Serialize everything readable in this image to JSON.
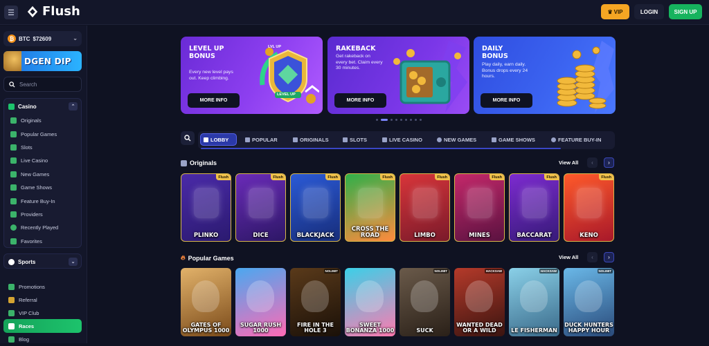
{
  "header": {
    "brand": "Flush",
    "vip_label": "VIP",
    "login_label": "LOGIN",
    "signup_label": "SIGN UP"
  },
  "sidebar": {
    "wallet": {
      "currency": "BTC",
      "amount": "$72609"
    },
    "promo_label": "DGEN DIP",
    "search_placeholder": "Search",
    "casino": {
      "label": "Casino",
      "items": [
        {
          "label": "Originals",
          "icon": "originals-icon"
        },
        {
          "label": "Popular Games",
          "icon": "flame-icon"
        },
        {
          "label": "Slots",
          "icon": "slots-icon"
        },
        {
          "label": "Live Casino",
          "icon": "live-icon"
        },
        {
          "label": "New Games",
          "icon": "new-icon"
        },
        {
          "label": "Game Shows",
          "icon": "tv-icon"
        },
        {
          "label": "Feature Buy-In",
          "icon": "buy-icon"
        },
        {
          "label": "Providers",
          "icon": "providers-icon"
        },
        {
          "label": "Recently Played",
          "icon": "history-icon"
        },
        {
          "label": "Favorites",
          "icon": "star-icon"
        }
      ]
    },
    "sports_label": "Sports",
    "links": [
      {
        "label": "Promotions",
        "icon": "gift-icon"
      },
      {
        "label": "Referral",
        "icon": "referral-icon"
      },
      {
        "label": "VIP Club",
        "icon": "crown-icon"
      },
      {
        "label": "Races",
        "icon": "flag-icon"
      },
      {
        "label": "Blog",
        "icon": "blog-icon"
      }
    ]
  },
  "hero_cards": [
    {
      "title": "LEVEL UP BONUS",
      "desc": "Every new level pays out. Keep climbing.",
      "button": "MORE INFO",
      "badge_top": "LVL UP",
      "badge_bottom": "LEVEL UP"
    },
    {
      "title": "RAKEBACK",
      "desc": "Get rakeback on every bet. Claim every 30 minutes.",
      "button": "MORE INFO"
    },
    {
      "title": "DAILY BONUS",
      "desc": "Play daily, earn daily. Bonus drops every 24 hours.",
      "button": "MORE INFO"
    }
  ],
  "carousel": {
    "count": 9,
    "active_index": 1
  },
  "tabs": [
    {
      "label": "LOBBY",
      "active": true
    },
    {
      "label": "POPULAR"
    },
    {
      "label": "ORIGINALS"
    },
    {
      "label": "SLOTS"
    },
    {
      "label": "LIVE CASINO"
    },
    {
      "label": "NEW GAMES"
    },
    {
      "label": "GAME SHOWS"
    },
    {
      "label": "FEATURE BUY-IN"
    }
  ],
  "originals": {
    "title": "Originals",
    "view_all": "View All",
    "tag": "Flush",
    "games": [
      "PLINKO",
      "DICE",
      "BLACKJACK",
      "CROSS THE ROAD",
      "LIMBO",
      "MINES",
      "BACCARAT",
      "KENO"
    ]
  },
  "popular": {
    "title": "Popular Games",
    "view_all": "View All",
    "games": [
      {
        "name": "GATES OF OLYMPUS 1000"
      },
      {
        "name": "SUGAR RUSH 1000"
      },
      {
        "name": "FIRE IN THE HOLE 3",
        "provider": "NOLIMIT"
      },
      {
        "name": "SWEET BONANZA 1000"
      },
      {
        "name": "SUCK",
        "provider": "NOLIMIT"
      },
      {
        "name": "WANTED DEAD OR A WILD",
        "provider": "HACKSAW"
      },
      {
        "name": "LE FISHERMAN",
        "provider": "HACKSAW"
      },
      {
        "name": "DUCK HUNTERS HAPPY HOUR",
        "provider": "NOLIMIT"
      }
    ]
  },
  "colors": {
    "background": "#0f1222",
    "accent_blue": "#2b39a8",
    "vip_gold": "#f5a623",
    "signup_green": "#16b35e"
  }
}
